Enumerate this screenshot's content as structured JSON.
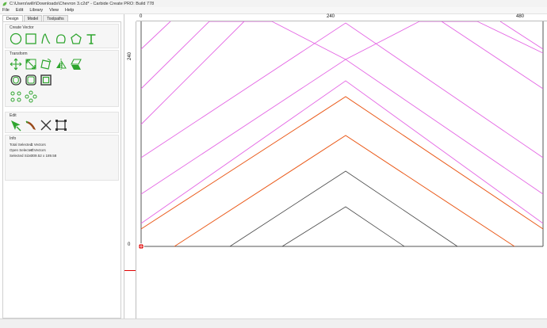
{
  "window": {
    "title": "C:\\Users\\willr\\Downloads\\Chevron 3.c2d* - Carbide Create PRO: Build 778",
    "app_icon": "carbide-leaf-icon"
  },
  "menubar": {
    "items": [
      {
        "label": "File"
      },
      {
        "label": "Edit"
      },
      {
        "label": "Library"
      },
      {
        "label": "View"
      },
      {
        "label": "Help"
      }
    ]
  },
  "tabs": [
    {
      "label": "Design",
      "active": true
    },
    {
      "label": "Model",
      "active": false
    },
    {
      "label": "Toolpaths",
      "active": false
    }
  ],
  "sections": {
    "create_vector": {
      "title": "Create Vector",
      "tools": [
        "circle-tool-icon",
        "rectangle-tool-icon",
        "curve-tool-icon",
        "polyline-tool-icon",
        "polygon-tool-icon",
        "text-tool-icon"
      ]
    },
    "transform": {
      "title": "Transform",
      "tools": [
        "move-tool-icon",
        "scale-tool-icon",
        "rotate-tool-icon",
        "mirror-tool-icon",
        "skew-tool-icon",
        "offset-tool-icon",
        "fillet-tool-icon",
        "boolean-tool-icon",
        "array-tool-icon",
        "circular-array-tool-icon",
        "pattern-array-tool-icon"
      ]
    },
    "edit": {
      "title": "Edit",
      "tools": [
        "node-edit-icon",
        "knife-tool-icon",
        "trim-tool-icon",
        "bounding-box-icon"
      ]
    },
    "info": {
      "title": "Info",
      "total_selected_label": "Total Selected:",
      "total_selected_value": "1 Vectors",
      "open_selected_label": "Open Selected:",
      "open_selected_value": "0 Vectors",
      "selected_size_label": "Selected Size:",
      "selected_size_value": "309.52 x 189.58"
    }
  },
  "rulers": {
    "top": [
      "0",
      "240",
      "480"
    ],
    "left": [
      "240",
      "0"
    ]
  },
  "colors": {
    "magenta": "#e466e4",
    "orange": "#ea5a1a",
    "gray": "#4a4a4a",
    "tool_green": "#2fa52f",
    "origin_red": "#e00000"
  }
}
